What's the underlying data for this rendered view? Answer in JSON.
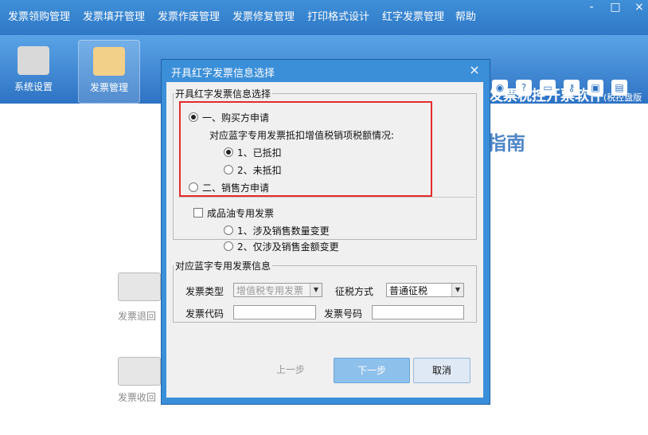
{
  "menu": [
    "发票领购管理",
    "发票填开管理",
    "发票作废管理",
    "发票修复管理",
    "打印格式设计",
    "红字发票管理",
    "帮助"
  ],
  "window_controls": {
    "minimize": "-",
    "maximize": "□",
    "close": "×"
  },
  "toolbar": {
    "items": [
      {
        "label": "系统设置",
        "icon": "settings-icon",
        "active": false
      },
      {
        "label": "发票管理",
        "icon": "invoice-management-icon",
        "active": true
      }
    ]
  },
  "brand": {
    "title": "增值税发票税控开票软件",
    "subtitle": "(税控盘版"
  },
  "small_icons": [
    "globe-icon",
    "help-icon",
    "window-icon",
    "key-icon",
    "lock-icon",
    "document-icon"
  ],
  "background": {
    "guide_text": "指南",
    "workflow": [
      {
        "label": "发票退回",
        "icon": "return-icon"
      },
      {
        "label": "发票收回",
        "icon": "recycle-icon"
      }
    ]
  },
  "dialog": {
    "title": "开具红字发票信息选择",
    "close_label": "×",
    "group1": {
      "legend": "开具红字发票信息选择",
      "buyer_option": "一、购买方申请",
      "deduction_question": "对应蓝字专用发票抵扣增值税销项税额情况:",
      "deducted": "1、已抵扣",
      "not_deducted": "2、未抵扣",
      "seller_option": "二、销售方申请",
      "oil_checkbox": "成品油专用发票",
      "oil_option1": "1、涉及销售数量变更",
      "oil_option2": "2、仅涉及销售金额变更"
    },
    "group2": {
      "legend": "对应蓝字专用发票信息",
      "invoice_type_label": "发票类型",
      "invoice_type_value": "增值税专用发票",
      "tax_method_label": "征税方式",
      "tax_method_value": "普通征税",
      "invoice_code_label": "发票代码",
      "invoice_number_label": "发票号码"
    },
    "buttons": {
      "prev": "上一步",
      "next": "下一步",
      "cancel": "取消"
    }
  },
  "colors": {
    "header_blue": "#3b8fd9",
    "highlight_red": "#e42b2b"
  }
}
